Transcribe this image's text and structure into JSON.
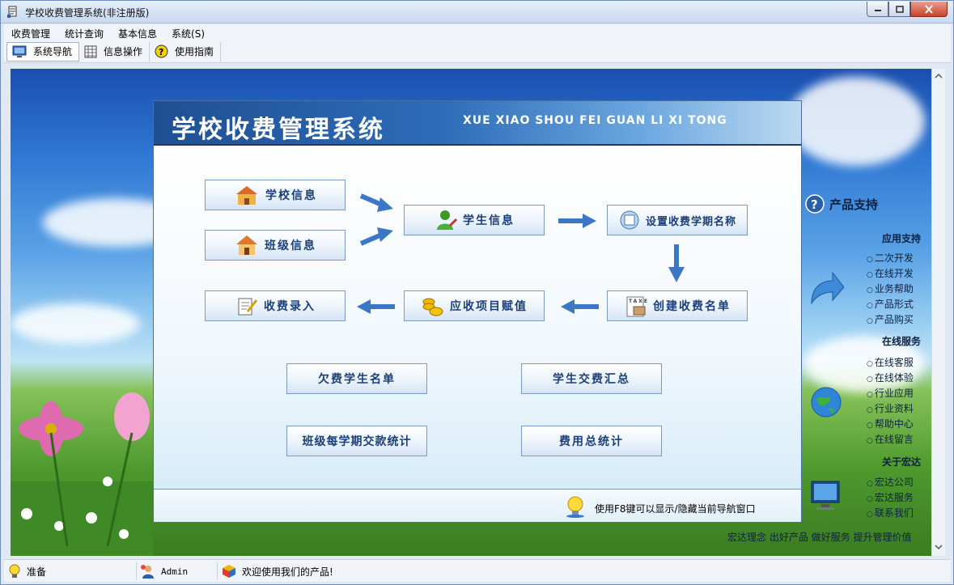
{
  "window": {
    "title": "学校收费管理系统(非注册版)"
  },
  "menu": [
    "收费管理",
    "统计查询",
    "基本信息",
    "系统(S)"
  ],
  "toolbar": [
    {
      "label": "系统导航",
      "icon": "monitor-icon"
    },
    {
      "label": "信息操作",
      "icon": "grid-icon"
    },
    {
      "label": "使用指南",
      "icon": "help-icon"
    }
  ],
  "panel": {
    "title": "学校收费管理系统",
    "subtitle": "XUE XIAO SHOU FEI GUAN LI XI TONG",
    "buttons": {
      "school_info": "学校信息",
      "class_info": "班级信息",
      "student_info": "学生信息",
      "term_name": "设置收费学期名称",
      "fee_entry": "收费录入",
      "assign_items": "应收项目赋值",
      "create_list": "创建收费名单",
      "arrears_list": "欠费学生名单",
      "payment_summary": "学生交费汇总",
      "class_term_stats": "班级每学期交款统计",
      "total_stats": "费用总统计"
    },
    "footer_hint": "使用F8键可以显示/隐藏当前导航窗口"
  },
  "side": {
    "title": "产品支持",
    "groups": [
      {
        "head": "应用支持",
        "links": [
          "二次开发",
          "在线开发",
          "业务帮助",
          "产品形式",
          "产品购买"
        ]
      },
      {
        "head": "在线服务",
        "links": [
          "在线客服",
          "在线体验",
          "行业应用",
          "行业资料",
          "帮助中心",
          "在线留言"
        ]
      },
      {
        "head": "关于宏达",
        "links": [
          "宏达公司",
          "宏达服务",
          "联系我们"
        ]
      }
    ],
    "slogan": "宏达理念 出好产品 做好服务 提升管理价值"
  },
  "status": {
    "ready": "准备",
    "user": "Admin",
    "welcome": "欢迎使用我们的产品!"
  },
  "colors": {
    "accent": "#1f4f93",
    "arrow": "#3a78c6"
  }
}
